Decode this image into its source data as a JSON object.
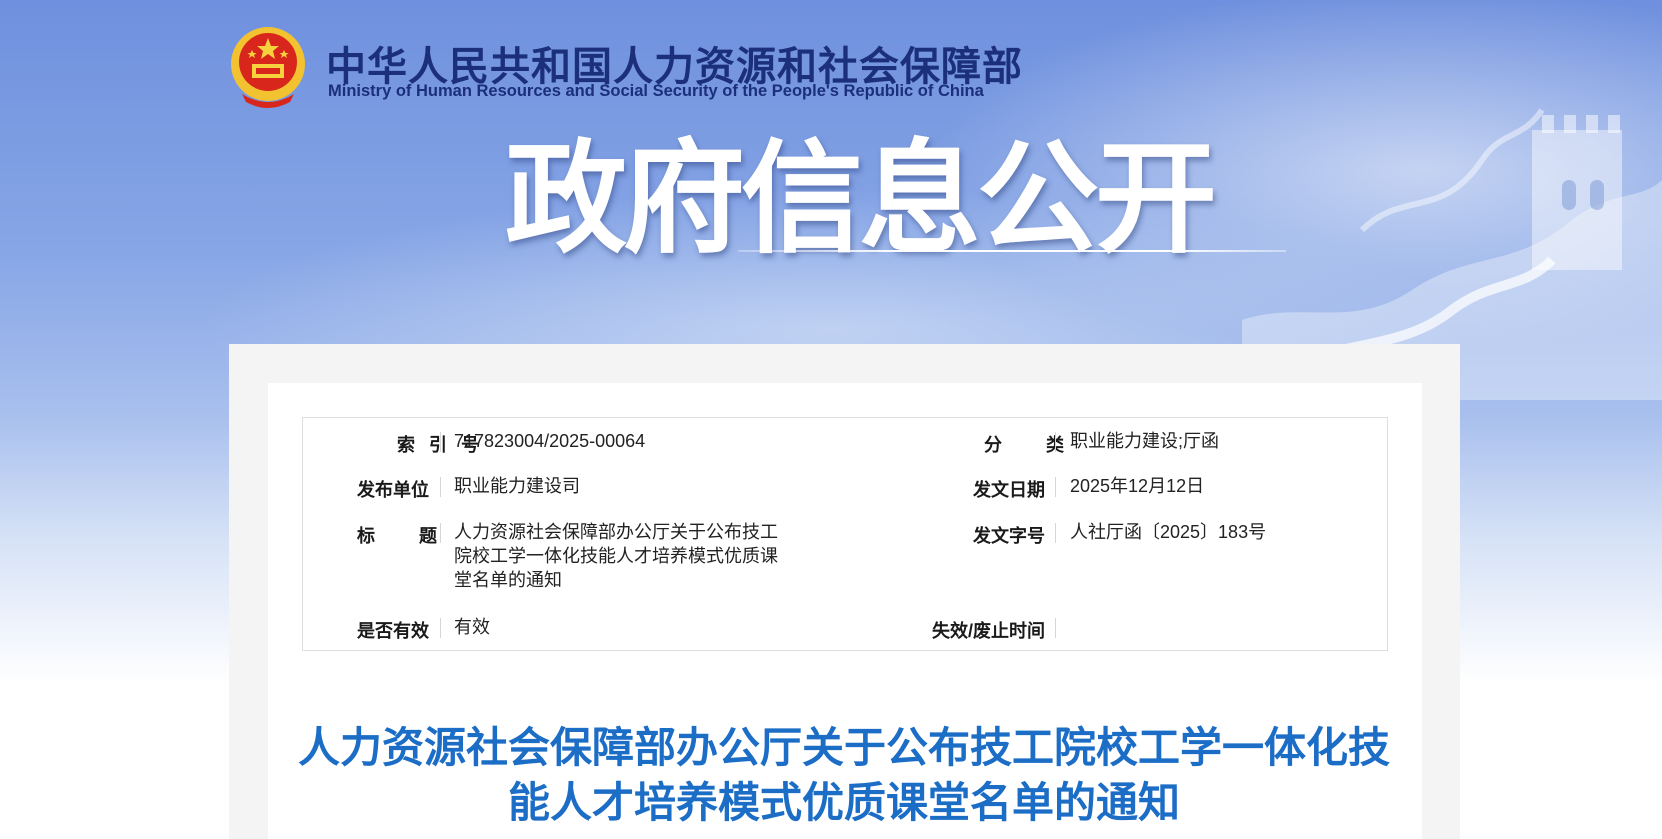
{
  "header": {
    "ministry_cn": "中华人民共和国人力资源和社会保障部",
    "ministry_en": "Ministry of Human Resources and Social Security of the People's Republic of China",
    "site_title": "政府信息公开",
    "emblem_icon": "national-emblem-icon"
  },
  "metadata": {
    "index_no": {
      "label": "索引号",
      "value": "717823004/2025-00064"
    },
    "category": {
      "label": "分类",
      "value": "职业能力建设;厅函"
    },
    "issuer": {
      "label": "发布单位",
      "value": "职业能力建设司"
    },
    "issue_date": {
      "label": "发文日期",
      "value": "2025年12月12日"
    },
    "title": {
      "label": "标题",
      "value": "人力资源社会保障部办公厅关于公布技工院校工学一体化技能人才培养模式优质课堂名单的通知"
    },
    "doc_no": {
      "label": "发文字号",
      "value": "人社厅函〔2025〕183号"
    },
    "validity": {
      "label": "是否有效",
      "value": "有效"
    },
    "expiry": {
      "label": "失效/废止时间",
      "value": ""
    }
  },
  "document": {
    "title": "人力资源社会保障部办公厅关于公布技工院校工学一体化技能人才培养模式优质课堂名单的通知"
  },
  "colors": {
    "ministry_text": "#1b2f7a",
    "doc_title": "#1c6dc6",
    "banner_top": "#6f90de"
  }
}
